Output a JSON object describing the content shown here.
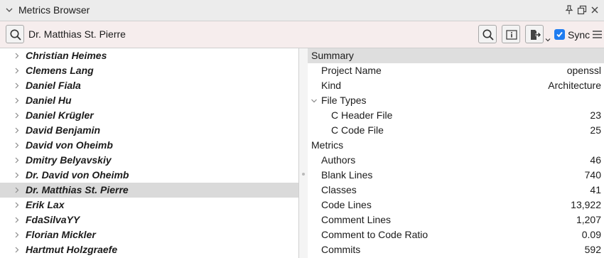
{
  "window": {
    "title": "Metrics Browser"
  },
  "search": {
    "value": "Dr. Matthias St. Pierre"
  },
  "toolbar": {
    "sync_label": "Sync",
    "sync_checked": true
  },
  "people": [
    "Christian Heimes",
    "Clemens Lang",
    "Daniel Fiala",
    "Daniel Hu",
    "Daniel Krügler",
    "David Benjamin",
    "David von Oheimb",
    "Dmitry Belyavskiy",
    "Dr. David von Oheimb",
    "Dr. Matthias St. Pierre",
    "Erik Lax",
    "FdaSilvaYY",
    "Florian Mickler",
    "Hartmut Holzgraefe"
  ],
  "selected_person": "Dr. Matthias St. Pierre",
  "properties": {
    "summary_header": "Summary",
    "project_name_label": "Project Name",
    "project_name_value": "openssl",
    "kind_label": "Kind",
    "kind_value": "Architecture",
    "file_types_label": "File Types",
    "c_header_label": "C Header File",
    "c_header_value": "23",
    "c_code_label": "C Code File",
    "c_code_value": "25",
    "metrics_header": "Metrics",
    "metrics": [
      {
        "label": "Authors",
        "value": "46"
      },
      {
        "label": "Blank Lines",
        "value": "740"
      },
      {
        "label": "Classes",
        "value": "41"
      },
      {
        "label": "Code Lines",
        "value": "13,922"
      },
      {
        "label": "Comment Lines",
        "value": "1,207"
      },
      {
        "label": "Comment to Code Ratio",
        "value": "0.09"
      },
      {
        "label": "Commits",
        "value": "592"
      }
    ]
  },
  "colors": {
    "accent": "#1f7cf0",
    "selection": "#dadada",
    "search_bg": "#f6eded",
    "header_bg": "#dedede"
  },
  "icons": {
    "collapse": "chevron-down-icon",
    "pin": "pin-icon",
    "float": "float-window-icon",
    "close": "close-icon",
    "search": "search-icon",
    "info": "info-icon",
    "export": "export-icon",
    "menu": "hamburger-menu-icon",
    "row_expand": "chevron-right-icon"
  }
}
